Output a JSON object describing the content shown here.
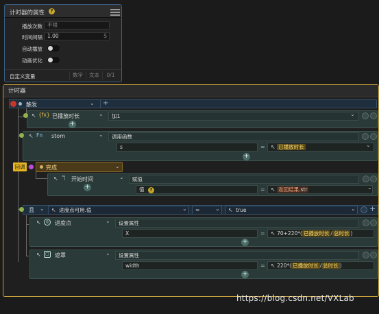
{
  "properties_panel": {
    "title": "计时器的属性",
    "help": "?",
    "rows": [
      {
        "label": "播放次数",
        "value": "不限"
      },
      {
        "label": "时间间隔",
        "value": "1.00",
        "suffix": "S"
      },
      {
        "label": "自动播放"
      },
      {
        "label": "动画优化"
      }
    ],
    "custom_var_label": "自定义变量",
    "tabs": [
      "数字",
      "文本",
      "0/1"
    ]
  },
  "timer": {
    "title": "计时器",
    "trigger": "触发",
    "block1": {
      "icon": "{fx}",
      "target": "已播放时长",
      "action": "加1"
    },
    "block2": {
      "icon": "Fn",
      "target": "stom",
      "action": "调用函数",
      "param": "s",
      "eq": "=",
      "value": "已播放时长"
    },
    "callback": {
      "label": "回调",
      "name": "完成"
    },
    "block3": {
      "target": "开始时间",
      "action": "赋值",
      "param": "值",
      "help": "?",
      "eq": "=",
      "value_prefix": "返回结果",
      "value_suffix": ".str"
    },
    "cond": {
      "kw": "且",
      "target": "进度点可用.值",
      "op": "=",
      "value": "true"
    },
    "block4": {
      "target": "进度点",
      "action": "设置属性",
      "param": "X",
      "eq": "=",
      "expr_pre": "70+220*(",
      "expr_a": "已播放时长",
      "expr_sep": "/",
      "expr_b": "总时长",
      "expr_post": ")"
    },
    "block5": {
      "target": "遮罩",
      "action": "设置属性",
      "param": "width",
      "eq": "=",
      "expr_pre": "220*(",
      "expr_a": "已播放时长",
      "expr_sep": "/",
      "expr_b": "总时长",
      "expr_post": ")"
    }
  },
  "watermark": "https://blog.csdn.net/VXLab"
}
